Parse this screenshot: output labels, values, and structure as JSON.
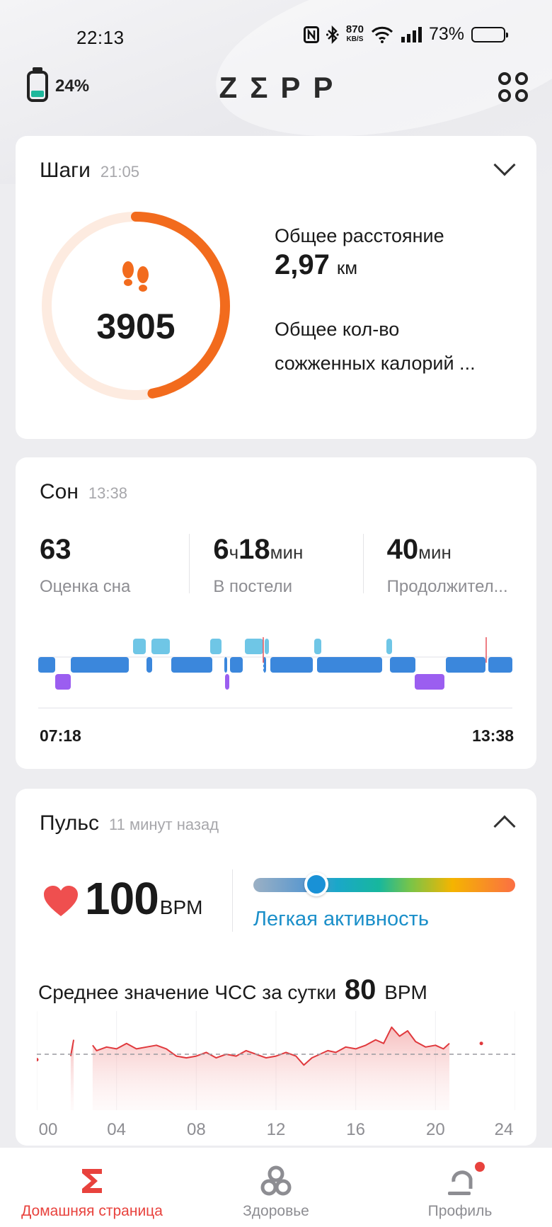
{
  "status_bar": {
    "time": "22:13",
    "speed_value": "870",
    "speed_unit": "KB/S",
    "battery_percent": "73%"
  },
  "header": {
    "watch_battery": "24%",
    "logo": "ZΣPP"
  },
  "steps": {
    "title": "Шаги",
    "time": "21:05",
    "count": "3905",
    "progress": 0.47,
    "distance_label": "Общее расстояние",
    "distance_value": "2,97",
    "distance_unit": "км",
    "calories_label_line1": "Общее кол-во",
    "calories_label_line2": "сожженных калорий ...",
    "accent_color": "#f26b1d"
  },
  "sleep": {
    "title": "Сон",
    "time": "13:38",
    "metrics": [
      {
        "value": "63",
        "unit": "",
        "label": "Оценка сна"
      },
      {
        "value_h": "6",
        "unit_h": "ч",
        "value_m": "18",
        "unit_m": "мин",
        "label": "В постели"
      },
      {
        "value": "40",
        "unit": "мин",
        "label": "Продолжител..."
      }
    ],
    "start_time": "07:18",
    "end_time": "13:38",
    "stage_colors": {
      "awake": "#6fc6e6",
      "light": "#3b87dc",
      "deep": "#9b5ef0",
      "marker": "#e8535a"
    }
  },
  "pulse": {
    "title": "Пульс",
    "time": "11 минут назад",
    "bpm": "100",
    "bpm_unit": "BPM",
    "zone_label": "Легкая активность",
    "zone_position": 0.24,
    "avg_label": "Среднее значение ЧСС за сутки",
    "avg_value": "80",
    "avg_unit": "BPM",
    "axis_labels": [
      "00",
      "04",
      "08",
      "12",
      "16",
      "20",
      "24"
    ]
  },
  "chart_data": {
    "type": "area",
    "title": "",
    "xlabel": "",
    "ylabel": "",
    "x_ticks": [
      "00",
      "04",
      "08",
      "12",
      "16",
      "20",
      "24"
    ],
    "baseline": 80,
    "series": [
      {
        "x": [
          0.0,
          1.7,
          1.85,
          2.8,
          3.0,
          3.5,
          4.0,
          4.5,
          5.0,
          5.5,
          6.0,
          6.5,
          7.0,
          7.5,
          8.0,
          8.5,
          9.0,
          9.5,
          10.0,
          10.5,
          11.0,
          11.5,
          12.0,
          12.5,
          13.0,
          13.4,
          13.8,
          14.2,
          14.6,
          15.0,
          15.5,
          16.0,
          16.5,
          17.0,
          17.4,
          17.8,
          18.2,
          18.6,
          19.0,
          19.5,
          20.0,
          20.4,
          20.7,
          22.3
        ],
        "y": [
          77,
          79,
          88,
          85,
          82,
          84,
          83,
          86,
          83,
          84,
          85,
          83,
          79,
          78,
          79,
          81,
          78,
          80,
          79,
          82,
          80,
          78,
          79,
          81,
          79,
          74,
          78,
          80,
          82,
          81,
          84,
          83,
          85,
          88,
          86,
          95,
          90,
          93,
          87,
          84,
          85,
          83,
          86,
          86
        ]
      }
    ]
  },
  "nav": {
    "items": [
      {
        "label": "Домашняя страница",
        "icon": "zepp-sigma-icon"
      },
      {
        "label": "Здоровье",
        "icon": "health-icon"
      },
      {
        "label": "Профиль",
        "icon": "profile-icon"
      }
    ],
    "active_color": "#e8423d"
  }
}
